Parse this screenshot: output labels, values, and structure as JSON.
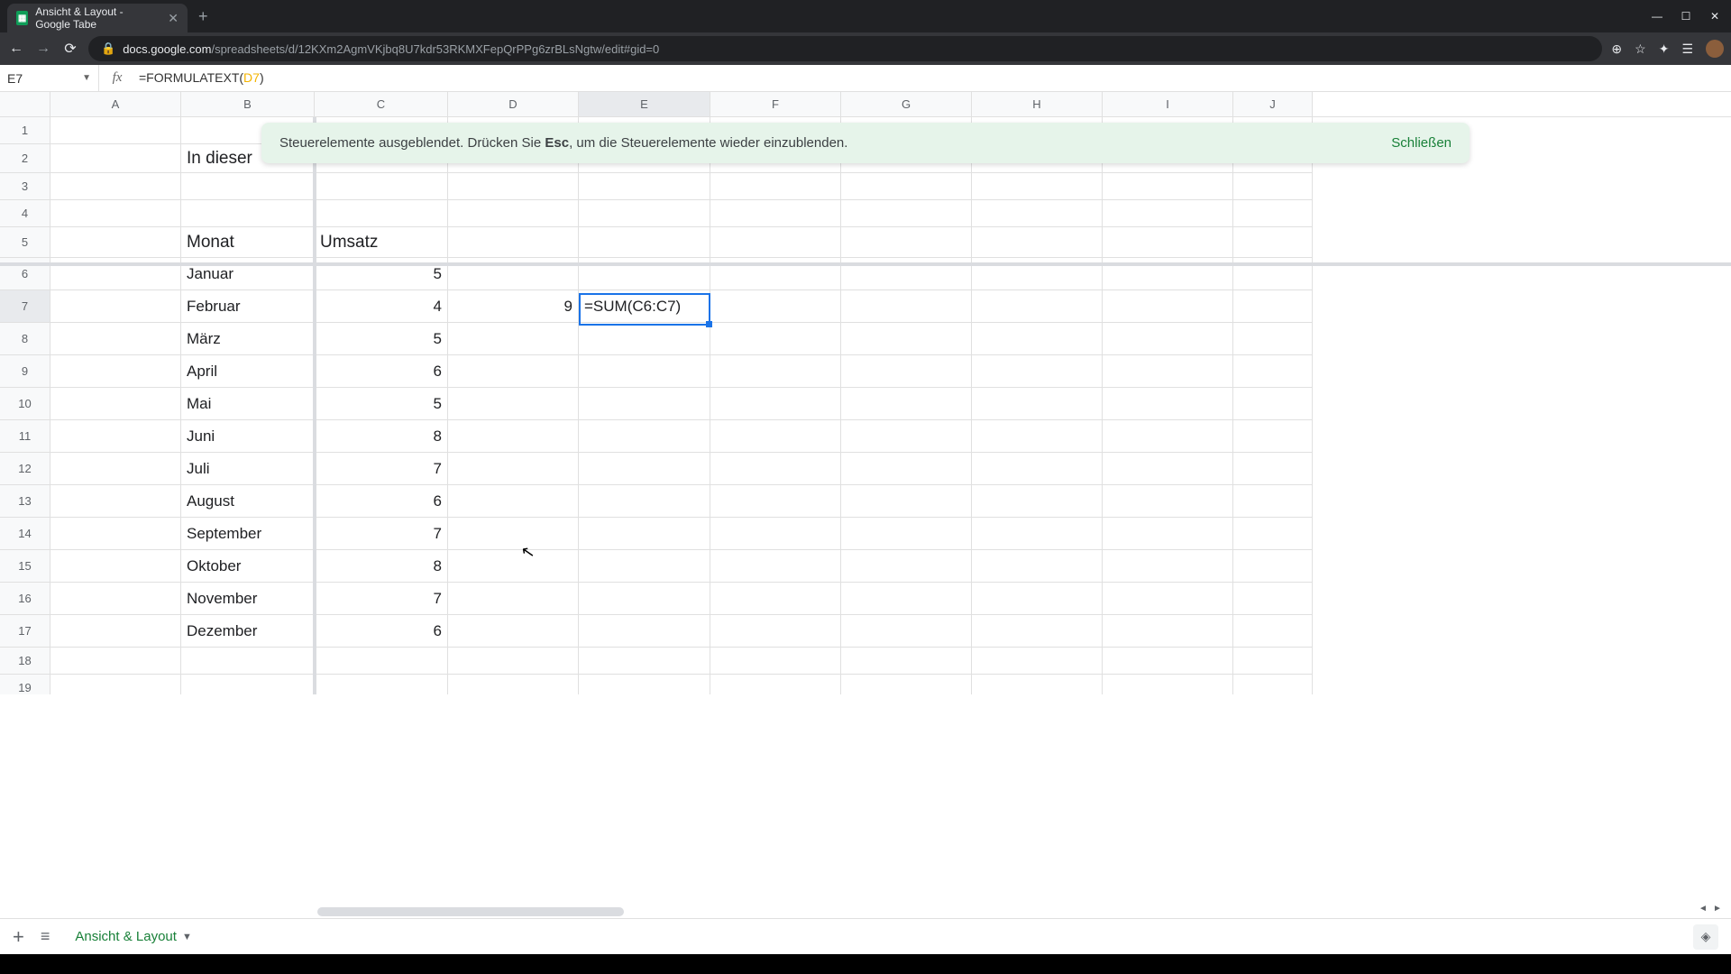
{
  "browser": {
    "tab_title": "Ansicht & Layout - Google Tabe",
    "url_lock": "🔒",
    "url_domain": "docs.google.com",
    "url_path": "/spreadsheets/d/12KXm2AgmVKjbq8U7kdr53RKMXFepQrPPg6zrBLsNgtw/edit#gid=0"
  },
  "name_box": "E7",
  "formula_prefix": "=FORMULATEXT(",
  "formula_ref": "D7",
  "formula_suffix": ")",
  "columns": [
    "A",
    "B",
    "C",
    "D",
    "E",
    "F",
    "G",
    "H",
    "I",
    "J"
  ],
  "banner": {
    "text_before": "Steuerelemente ausgeblendet. Drücken Sie ",
    "key": "Esc",
    "text_after": ", um die Steuerelemente wieder einzublenden.",
    "close": "Schließen"
  },
  "sheet": {
    "b2": "In dieser",
    "b5": "Monat",
    "c5": "Umsatz",
    "months": [
      "Januar",
      "Februar",
      "März",
      "April",
      "Mai",
      "Juni",
      "Juli",
      "August",
      "September",
      "Oktober",
      "November",
      "Dezember"
    ],
    "values": [
      "5",
      "4",
      "5",
      "6",
      "5",
      "8",
      "7",
      "6",
      "7",
      "8",
      "7",
      "6"
    ],
    "d7": "9",
    "e7": "=SUM(C6:C7)"
  },
  "sheet_tab": "Ansicht & Layout"
}
